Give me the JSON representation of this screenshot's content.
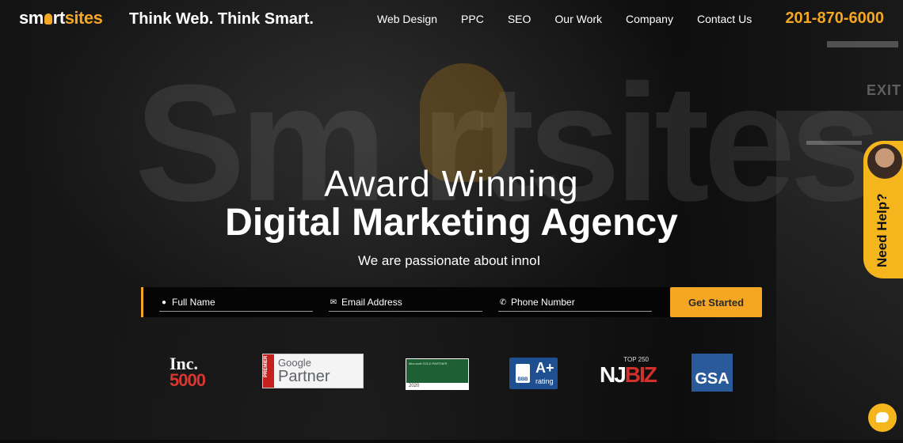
{
  "brand": {
    "logo_pre": "sm",
    "logo_mid": "rt",
    "logo_post": "sites",
    "tagline": "Think Web. Think Smart."
  },
  "nav": {
    "items": [
      "Web Design",
      "PPC",
      "SEO",
      "Our Work",
      "Company",
      "Contact Us"
    ],
    "phone": "201-870-6000"
  },
  "hero": {
    "line1": "Award Winning",
    "line2": "Digital Marketing Agency",
    "subtitle": "We are passionate about innoI"
  },
  "form": {
    "full_name_placeholder": "Full Name",
    "email_placeholder": "Email Address",
    "phone_placeholder": "Phone Number",
    "submit_label": "Get Started"
  },
  "badges": {
    "inc_title": "Inc.",
    "inc_number": "5000",
    "google_word": "Google",
    "google_partner": "Partner",
    "google_strip": "PREMIER",
    "ms_text": "Microsoft GOLD PARTNER",
    "ms_year": "2020",
    "bbb_grade": "A+",
    "bbb_rating": "rating",
    "bbb_logo": "BBB",
    "njbiz_top": "TOP 250",
    "njbiz_nj": "NJ",
    "njbiz_biz": "BIZ",
    "gsa": "GSA"
  },
  "help_widget": {
    "label": "Need Help?"
  },
  "wall_sign": {
    "exit": "EXIT"
  },
  "colors": {
    "accent": "#f5a623",
    "help_bg": "#f5b61d"
  }
}
